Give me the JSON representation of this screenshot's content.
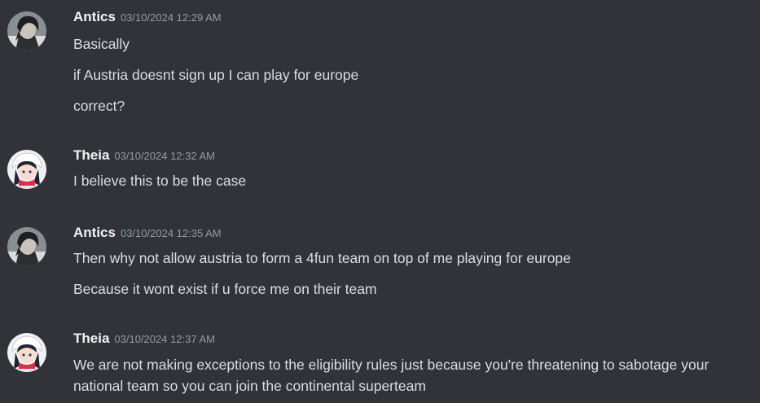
{
  "messages": [
    {
      "author": "Antics",
      "timestamp": "03/10/2024 12:29 AM",
      "avatar": "dark-haired-character-avatar",
      "lines": [
        "Basically",
        "if Austria doesnt sign up I can play for europe",
        "correct?"
      ]
    },
    {
      "author": "Theia",
      "timestamp": "03/10/2024 12:32 AM",
      "avatar": "white-hat-character-avatar",
      "lines": [
        "I believe this to be the case"
      ]
    },
    {
      "author": "Antics",
      "timestamp": "03/10/2024 12:35 AM",
      "avatar": "dark-haired-character-avatar",
      "lines": [
        "Then why not allow austria to form a 4fun team on top of me playing for europe",
        "Because it wont exist if u force me on their team"
      ]
    },
    {
      "author": "Theia",
      "timestamp": "03/10/2024 12:37 AM",
      "avatar": "white-hat-character-avatar",
      "lines": [
        "We are not making exceptions to the eligibility rules just because you're threatening to sabotage your national team so you can join the continental superteam"
      ]
    }
  ],
  "colors": {
    "background": "#313338",
    "username": "#f2f3f5",
    "timestamp": "#949ba4",
    "text": "#dbdee1"
  }
}
